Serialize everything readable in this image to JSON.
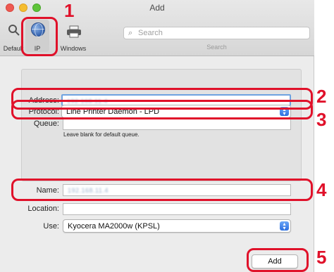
{
  "window": {
    "title": "Add"
  },
  "toolbar": {
    "items": [
      {
        "label": "Default",
        "icon": "default-printer-icon"
      },
      {
        "label": "IP",
        "icon": "globe-icon"
      },
      {
        "label": "Windows",
        "icon": "windows-printer-icon"
      }
    ],
    "search_placeholder": "Search",
    "search_caption": "Search"
  },
  "form": {
    "address_label": "Address:",
    "address_value": "192.168.11.4",
    "protocol_label": "Protocol:",
    "protocol_value": "Line Printer Daemon - LPD",
    "queue_label": "Queue:",
    "queue_value": "",
    "queue_hint": "Leave blank for default queue.",
    "name_label": "Name:",
    "name_value": "192.168.11.4",
    "location_label": "Location:",
    "location_value": "",
    "use_label": "Use:",
    "use_value": "Kyocera MA2000w (KPSL)"
  },
  "buttons": {
    "add_label": "Add"
  },
  "callouts": [
    "1",
    "2",
    "3",
    "4",
    "5"
  ],
  "colors": {
    "callout_red": "#e0112a",
    "focus_blue": "#6ea2e0",
    "select_arrow_blue": "#2c6fe0"
  }
}
